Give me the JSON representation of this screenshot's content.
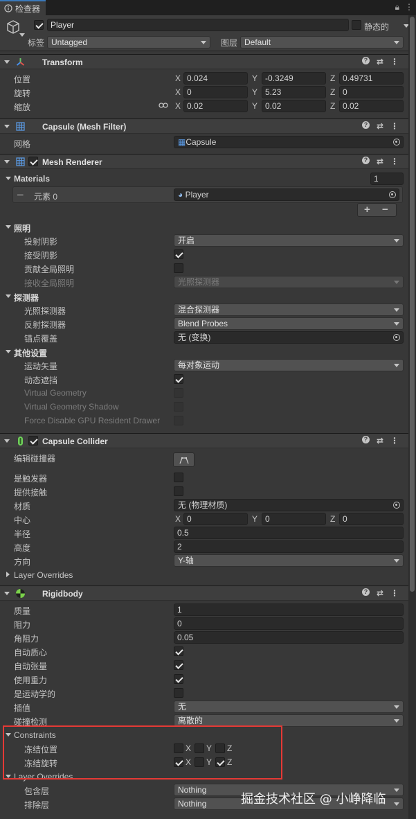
{
  "tab": {
    "title": "检查器"
  },
  "header": {
    "name": "Player",
    "static_label": "静态的",
    "tag_label": "标签",
    "tag_value": "Untagged",
    "layer_label": "图层",
    "layer_value": "Default"
  },
  "transform": {
    "title": "Transform",
    "pos_label": "位置",
    "rot_label": "旋转",
    "scale_label": "缩放",
    "pos": {
      "x": "0.024",
      "y": "-0.3249",
      "z": "0.49731"
    },
    "rot": {
      "x": "0",
      "y": "5.23",
      "z": "0"
    },
    "scale": {
      "x": "0.02",
      "y": "0.02",
      "z": "0.02"
    }
  },
  "axes": {
    "x": "X",
    "y": "Y",
    "z": "Z"
  },
  "mesh_filter": {
    "title": "Capsule (Mesh Filter)",
    "mesh_label": "网格",
    "mesh_value": "Capsule"
  },
  "mesh_renderer": {
    "title": "Mesh Renderer",
    "materials_label": "Materials",
    "materials_count": "1",
    "element_label": "元素 0",
    "element_value": "Player",
    "plus": "+",
    "minus": "−",
    "lighting_label": "照明",
    "cast_shadows_label": "投射阴影",
    "cast_shadows_value": "开启",
    "receive_shadows_label": "接受阴影",
    "contribute_gi_label": "贡献全局照明",
    "receive_gi_label": "接收全局照明",
    "receive_gi_value": "光照探测器",
    "probes_label": "探测器",
    "light_probes_label": "光照探测器",
    "light_probes_value": "混合探测器",
    "reflection_probes_label": "反射探测器",
    "reflection_probes_value": "Blend Probes",
    "anchor_label": "锚点覆盖",
    "anchor_value": "无 (变换)",
    "additional_label": "其他设置",
    "motion_vectors_label": "运动矢量",
    "motion_vectors_value": "每对象运动",
    "dynamic_occlusion_label": "动态遮挡",
    "vg_label": "Virtual Geometry",
    "vg_shadow_label": "Virtual Geometry Shadow",
    "force_disable_label": "Force Disable GPU Resident Drawer"
  },
  "capsule_collider": {
    "title": "Capsule Collider",
    "edit_label": "编辑碰撞器",
    "is_trigger_label": "是触发器",
    "provides_contacts_label": "提供接触",
    "material_label": "材质",
    "material_value": "无 (物理材质)",
    "center_label": "中心",
    "center": {
      "x": "0",
      "y": "0",
      "z": "0"
    },
    "radius_label": "半径",
    "radius_value": "0.5",
    "height_label": "高度",
    "height_value": "2",
    "direction_label": "方向",
    "direction_value": "Y-轴",
    "layer_overrides_label": "Layer Overrides"
  },
  "rigidbody": {
    "title": "Rigidbody",
    "mass_label": "质量",
    "mass_value": "1",
    "drag_label": "阻力",
    "drag_value": "0",
    "angular_drag_label": "角阻力",
    "angular_drag_value": "0.05",
    "auto_com_label": "自动质心",
    "auto_tensor_label": "自动张量",
    "use_gravity_label": "使用重力",
    "is_kinematic_label": "是运动学的",
    "interpolate_label": "插值",
    "interpolate_value": "无",
    "collision_label": "碰撞检测",
    "collision_value": "离散的",
    "constraints_label": "Constraints",
    "freeze_pos_label": "冻结位置",
    "freeze_rot_label": "冻结旋转",
    "layer_overrides_label": "Layer Overrides",
    "include_label": "包含层",
    "include_value": "Nothing",
    "exclude_label": "排除层",
    "exclude_value": "Nothing"
  },
  "watermark": "掘金技术社区 @ 小峥降临"
}
